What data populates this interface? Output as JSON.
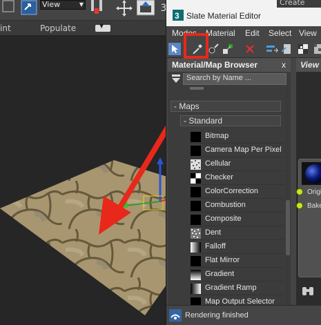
{
  "background_app": {
    "view_dropdown": "View",
    "ribbon_left": "int",
    "ribbon_populate": "Populate",
    "create_selection_partial": "Create Selec"
  },
  "slate": {
    "title": "Slate Material Editor",
    "menu": [
      "Modes",
      "Material",
      "Edit",
      "Select",
      "View"
    ],
    "browser_title": "Material/Map Browser",
    "browser_close": "x",
    "search_placeholder": "Search by Name ...",
    "maps_group": "- Maps",
    "standard_group": "- Standard",
    "maps": [
      {
        "label": "Bitmap",
        "swatch": "black"
      },
      {
        "label": "Camera Map Per Pixel",
        "swatch": "black"
      },
      {
        "label": "Cellular",
        "swatch": "cellular"
      },
      {
        "label": "Checker",
        "swatch": "checker"
      },
      {
        "label": "ColorCorrection",
        "swatch": "black"
      },
      {
        "label": "Combustion",
        "swatch": "black"
      },
      {
        "label": "Composite",
        "swatch": "black"
      },
      {
        "label": "Dent",
        "swatch": "dent"
      },
      {
        "label": "Falloff",
        "swatch": "falloff"
      },
      {
        "label": "Flat Mirror",
        "swatch": "black"
      },
      {
        "label": "Gradient",
        "swatch": "gradient"
      },
      {
        "label": "Gradient Ramp",
        "swatch": "gradient-ramp"
      },
      {
        "label": "Map Output Selector",
        "swatch": "black"
      }
    ],
    "view_tab": "View",
    "node_ports": [
      "Origin",
      "Bake"
    ],
    "status_text": "Rendering finished"
  },
  "colors": {
    "annotation_red": "#e8281a",
    "port_green": "#c6e620"
  }
}
